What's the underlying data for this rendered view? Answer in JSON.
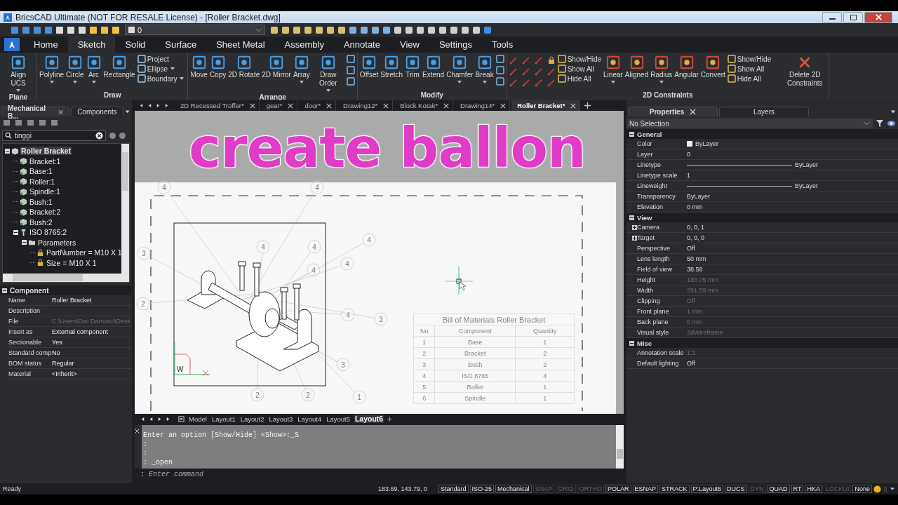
{
  "window": {
    "title": "BricsCAD Ultimate (NOT FOR RESALE License) - [Roller Bracket.dwg]"
  },
  "quick_access": {
    "layer_value": "0"
  },
  "ribbon_tabs": [
    {
      "label": "Home",
      "selected": false
    },
    {
      "label": "Sketch",
      "selected": true
    },
    {
      "label": "Solid",
      "selected": false
    },
    {
      "label": "Surface",
      "selected": false
    },
    {
      "label": "Sheet Metal",
      "selected": false
    },
    {
      "label": "Assembly",
      "selected": false
    },
    {
      "label": "Annotate",
      "selected": false
    },
    {
      "label": "View",
      "selected": false
    },
    {
      "label": "Settings",
      "selected": false
    },
    {
      "label": "Tools",
      "selected": false
    }
  ],
  "ribbon_panels": [
    {
      "title": "Plane",
      "tools": [
        {
          "kind": "large",
          "label": "Align UCS",
          "dropdown": true
        }
      ]
    },
    {
      "title": "Draw",
      "tools": [
        {
          "kind": "large",
          "label": "Polyline",
          "dropdown": true
        },
        {
          "kind": "large",
          "label": "Circle",
          "dropdown": true
        },
        {
          "kind": "large",
          "label": "Arc",
          "dropdown": true
        },
        {
          "kind": "large",
          "label": "Rectangle",
          "dropdown": false
        },
        {
          "kind": "smalls",
          "items": [
            {
              "label": "Project",
              "dropdown": false
            },
            {
              "label": "Ellipse",
              "dropdown": true
            },
            {
              "label": "Boundary",
              "dropdown": true
            }
          ]
        }
      ]
    },
    {
      "title": "Arrange",
      "tools": [
        {
          "kind": "large",
          "label": "Move",
          "dropdown": false
        },
        {
          "kind": "large",
          "label": "Copy",
          "dropdown": false
        },
        {
          "kind": "large",
          "label": "2D Rotate",
          "dropdown": false
        },
        {
          "kind": "large",
          "label": "2D Mirror",
          "dropdown": false
        },
        {
          "kind": "large",
          "label": "Array",
          "dropdown": true
        },
        {
          "kind": "large",
          "label": "Draw Order",
          "dropdown": true
        },
        {
          "kind": "icon_column"
        }
      ]
    },
    {
      "title": "Modify",
      "tools": [
        {
          "kind": "large",
          "label": "Offset",
          "dropdown": false
        },
        {
          "kind": "large",
          "label": "Stretch",
          "dropdown": false
        },
        {
          "kind": "large",
          "label": "Trim",
          "dropdown": false
        },
        {
          "kind": "large",
          "label": "Extend",
          "dropdown": false
        },
        {
          "kind": "large",
          "label": "Chamfer",
          "dropdown": true
        },
        {
          "kind": "large",
          "label": "Break",
          "dropdown": true
        },
        {
          "kind": "icon_column"
        }
      ]
    },
    {
      "title": "2D Constraints",
      "tools": [
        {
          "kind": "icon_grid"
        },
        {
          "kind": "smalls",
          "items": [
            {
              "label": "Show/Hide",
              "dropdown": false
            },
            {
              "label": "Show All",
              "dropdown": false
            },
            {
              "label": "Hide All",
              "dropdown": false
            }
          ]
        },
        {
          "kind": "large",
          "label": "Linear",
          "dropdown": true
        },
        {
          "kind": "large",
          "label": "Aligned",
          "dropdown": false
        },
        {
          "kind": "large",
          "label": "Radius",
          "dropdown": true
        },
        {
          "kind": "large",
          "label": "Angular",
          "dropdown": false
        },
        {
          "kind": "large",
          "label": "Convert",
          "dropdown": false
        },
        {
          "kind": "smalls",
          "items": [
            {
              "label": "Show/Hide",
              "dropdown": false
            },
            {
              "label": "Show All",
              "dropdown": false
            },
            {
              "label": "Hide All",
              "dropdown": false
            }
          ]
        },
        {
          "kind": "delete",
          "label": "Delete 2D Constraints",
          "dropdown": false
        }
      ]
    }
  ],
  "left_panel": {
    "tabs": [
      {
        "label": "Mechanical B...",
        "selected": true
      },
      {
        "label": "Components",
        "selected": false
      }
    ],
    "search": {
      "value": "tinggi"
    },
    "tree": [
      {
        "label": "Roller Bracket",
        "kind": "assembly",
        "selected": true,
        "expanded": true,
        "children": [
          {
            "label": "Bracket:1",
            "kind": "part",
            "selected": false
          },
          {
            "label": "Base:1",
            "kind": "part",
            "selected": false
          },
          {
            "label": "Roller:1",
            "kind": "part",
            "selected": false
          },
          {
            "label": "Spindle:1",
            "kind": "part",
            "selected": false
          },
          {
            "label": "Bush:1",
            "kind": "part",
            "selected": false
          },
          {
            "label": "Bracket:2",
            "kind": "part",
            "selected": false
          },
          {
            "label": "Bush:2",
            "kind": "part",
            "selected": false
          },
          {
            "label": "ISO 8765:2",
            "kind": "fastener",
            "selected": false,
            "expanded": true,
            "children": [
              {
                "label": "Parameters",
                "kind": "folder",
                "selected": false,
                "expanded": true,
                "children": [
                  {
                    "label": "PartNumber = M10 X 1",
                    "kind": "parameter",
                    "selected": false
                  },
                  {
                    "label": "Size = M10 X 1",
                    "kind": "parameter",
                    "selected": false
                  }
                ]
              }
            ]
          }
        ]
      }
    ],
    "component": {
      "title": "Component",
      "rows": [
        {
          "label": "Name",
          "value": "Roller Bracket",
          "disabled": false
        },
        {
          "label": "Description"
        },
        {
          "label": "File",
          "value": "C:\\Users\\Dwi Darsono\\Desk",
          "disabled": true
        },
        {
          "label": "Insert as",
          "value": "External component",
          "disabled": false
        },
        {
          "label": "Sectionable",
          "value": "Yes",
          "disabled": false
        },
        {
          "label": "Standard comp",
          "value": "No",
          "disabled": false
        },
        {
          "label": "BOM status",
          "value": "Regular",
          "disabled": false
        },
        {
          "label": "Material",
          "value": "<Inherit>",
          "disabled": false
        }
      ]
    }
  },
  "doc_tabs": [
    {
      "label": "2D Recessed Troffer*",
      "selected": false
    },
    {
      "label": "gear*",
      "selected": false
    },
    {
      "label": "door*",
      "selected": false
    },
    {
      "label": "Drawing12*",
      "selected": false
    },
    {
      "label": "Block Kotak*",
      "selected": false
    },
    {
      "label": "Drawing14*",
      "selected": false
    },
    {
      "label": "Roller Bracket*",
      "selected": true
    }
  ],
  "canvas": {
    "overlay_title": "create ballon",
    "balloons": [
      {
        "label": "4"
      },
      {
        "label": "4"
      },
      {
        "label": "4"
      },
      {
        "label": "4"
      },
      {
        "label": "4"
      },
      {
        "label": "4"
      },
      {
        "label": "4"
      },
      {
        "label": "3"
      },
      {
        "label": "2"
      },
      {
        "label": "3"
      },
      {
        "label": "4"
      },
      {
        "label": "3"
      },
      {
        "label": "2"
      },
      {
        "label": "2"
      },
      {
        "label": "1"
      }
    ],
    "ucs_label": "W",
    "bom": {
      "title": "Bill of Materials Roller Bracket",
      "columns": [
        "No",
        "Component",
        "Quantity"
      ],
      "rows": [
        [
          "1",
          "Base",
          "1"
        ],
        [
          "2",
          "Bracket",
          "2"
        ],
        [
          "3",
          "Bush",
          "2"
        ],
        [
          "4",
          "ISO 8765",
          "4"
        ],
        [
          "5",
          "Roller",
          "1"
        ],
        [
          "6",
          "Spindle",
          "1"
        ]
      ]
    }
  },
  "layout_tabs": [
    {
      "label": "Model",
      "selected": false
    },
    {
      "label": "Layout1",
      "selected": false
    },
    {
      "label": "Layout2",
      "selected": false
    },
    {
      "label": "Layout3",
      "selected": false
    },
    {
      "label": "Layout4",
      "selected": false
    },
    {
      "label": "Layout5",
      "selected": false
    },
    {
      "label": "Layout6",
      "selected": true
    }
  ],
  "command": {
    "history": [
      "Enter an option [Show/Hide] <Show>:_S",
      ":",
      ":",
      ": _open"
    ],
    "prompt": ":",
    "placeholder": "Enter command"
  },
  "properties": {
    "tabs": [
      {
        "label": "Properties",
        "selected": true
      },
      {
        "label": "Layers",
        "selected": false
      }
    ],
    "selection": "No Selection",
    "sections": [
      {
        "title": "General",
        "expanded": true,
        "rows": [
          {
            "label": "Color",
            "value": "ByLayer",
            "kind": "color",
            "disabled": false,
            "expandable": false
          },
          {
            "label": "Layer",
            "value": "0",
            "kind": "text",
            "disabled": false,
            "expandable": false
          },
          {
            "label": "Linetype",
            "value": "ByLayer",
            "kind": "line",
            "disabled": false,
            "expandable": false
          },
          {
            "label": "Linetype scale",
            "value": "1",
            "kind": "text",
            "disabled": false,
            "expandable": false
          },
          {
            "label": "Lineweight",
            "value": "ByLayer",
            "kind": "line",
            "disabled": false,
            "expandable": false
          },
          {
            "label": "Transparency",
            "value": "ByLayer",
            "kind": "text",
            "disabled": false,
            "expandable": false
          },
          {
            "label": "Elevation",
            "value": "0 mm",
            "kind": "text",
            "disabled": false,
            "expandable": false
          }
        ]
      },
      {
        "title": "View",
        "expanded": true,
        "rows": [
          {
            "label": "Camera",
            "value": "0, 0, 1",
            "kind": "text",
            "disabled": false,
            "expandable": true
          },
          {
            "label": "Target",
            "value": "0, 0, 0",
            "kind": "text",
            "disabled": false,
            "expandable": true
          },
          {
            "label": "Perspective",
            "value": "Off",
            "kind": "text",
            "disabled": false,
            "expandable": false
          },
          {
            "label": "Lens length",
            "value": "50 mm",
            "kind": "text",
            "disabled": false,
            "expandable": false
          },
          {
            "label": "Field of view",
            "value": "38.58",
            "kind": "text",
            "disabled": false,
            "expandable": false
          },
          {
            "label": "Height",
            "value": "180.75 mm",
            "kind": "text",
            "disabled": true,
            "expandable": false
          },
          {
            "label": "Width",
            "value": "291.59 mm",
            "kind": "text",
            "disabled": true,
            "expandable": false
          },
          {
            "label": "Clipping",
            "value": "Off",
            "kind": "text",
            "disabled": true,
            "expandable": false
          },
          {
            "label": "Front plane",
            "value": "1 mm",
            "kind": "text",
            "disabled": true,
            "expandable": false
          },
          {
            "label": "Back plane",
            "value": "0 mm",
            "kind": "text",
            "disabled": true,
            "expandable": false
          },
          {
            "label": "Visual style",
            "value": "2dWireframe",
            "kind": "text",
            "disabled": true,
            "expandable": false
          }
        ]
      },
      {
        "title": "Misc",
        "expanded": true,
        "rows": [
          {
            "label": "Annotation scale",
            "value": "1:1",
            "kind": "text",
            "disabled": true,
            "expandable": false
          },
          {
            "label": "Default lighting",
            "value": "Off",
            "kind": "text",
            "disabled": false,
            "expandable": false
          }
        ]
      }
    ]
  },
  "status_bar": {
    "message": "Ready",
    "coordinates": "183.69, 143.79, 0",
    "items": [
      {
        "label": "Standard",
        "on": true
      },
      {
        "label": "ISO-25",
        "on": true
      },
      {
        "label": "Mechanical",
        "on": true
      },
      {
        "label": "SNAP",
        "on": false
      },
      {
        "label": "GRID",
        "on": false
      },
      {
        "label": "ORTHO",
        "on": false
      },
      {
        "label": "POLAR",
        "on": true
      },
      {
        "label": "ESNAP",
        "on": true
      },
      {
        "label": "STRACK",
        "on": true
      },
      {
        "label": "P:Layout6",
        "on": true
      },
      {
        "label": "DUCS",
        "on": true
      },
      {
        "label": "DYN",
        "on": false
      },
      {
        "label": "QUAD",
        "on": true
      },
      {
        "label": "RT",
        "on": true
      },
      {
        "label": "HKA",
        "on": true
      },
      {
        "label": "LOCKUI",
        "on": false
      },
      {
        "label": "None",
        "on": true
      }
    ]
  }
}
